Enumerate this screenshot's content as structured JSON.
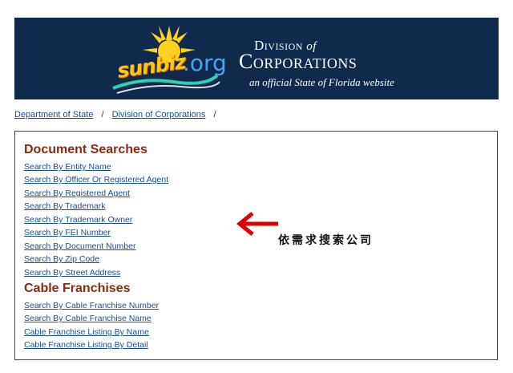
{
  "banner": {
    "logo_sunbiz": "sunbiz",
    "logo_org": ".org",
    "division_prefix": "Division",
    "division_of": "of",
    "corporations": "Corporations",
    "tagline": "an official State of Florida website"
  },
  "breadcrumb": {
    "items": [
      "Department of State",
      "Division of Corporations"
    ],
    "separator": "/"
  },
  "document_searches": {
    "title": "Document Searches",
    "links": [
      "Search By Entity Name",
      "Search By Officer Or Registered Agent",
      "Search By Registered Agent",
      "Search By Trademark",
      "Search By Trademark Owner",
      "Search By FEI Number",
      "Search By Document Number",
      "Search By Zip Code",
      "Search By Street Address"
    ]
  },
  "cable_franchises": {
    "title": "Cable Franchises",
    "links": [
      "Search By Cable Franchise Number",
      "Search By Cable Franchise Name",
      "Cable Franchise Listing By Name",
      "Cable Franchise Listing By Detail"
    ]
  },
  "annotation": {
    "text": "依需求搜索公司",
    "arrow_icon": "red-left-arrow-icon",
    "arrow_color": "#e00000"
  },
  "colors": {
    "banner_bg": "#0f2a4c",
    "heading": "#8b2a10",
    "link": "#1a4d8f"
  }
}
